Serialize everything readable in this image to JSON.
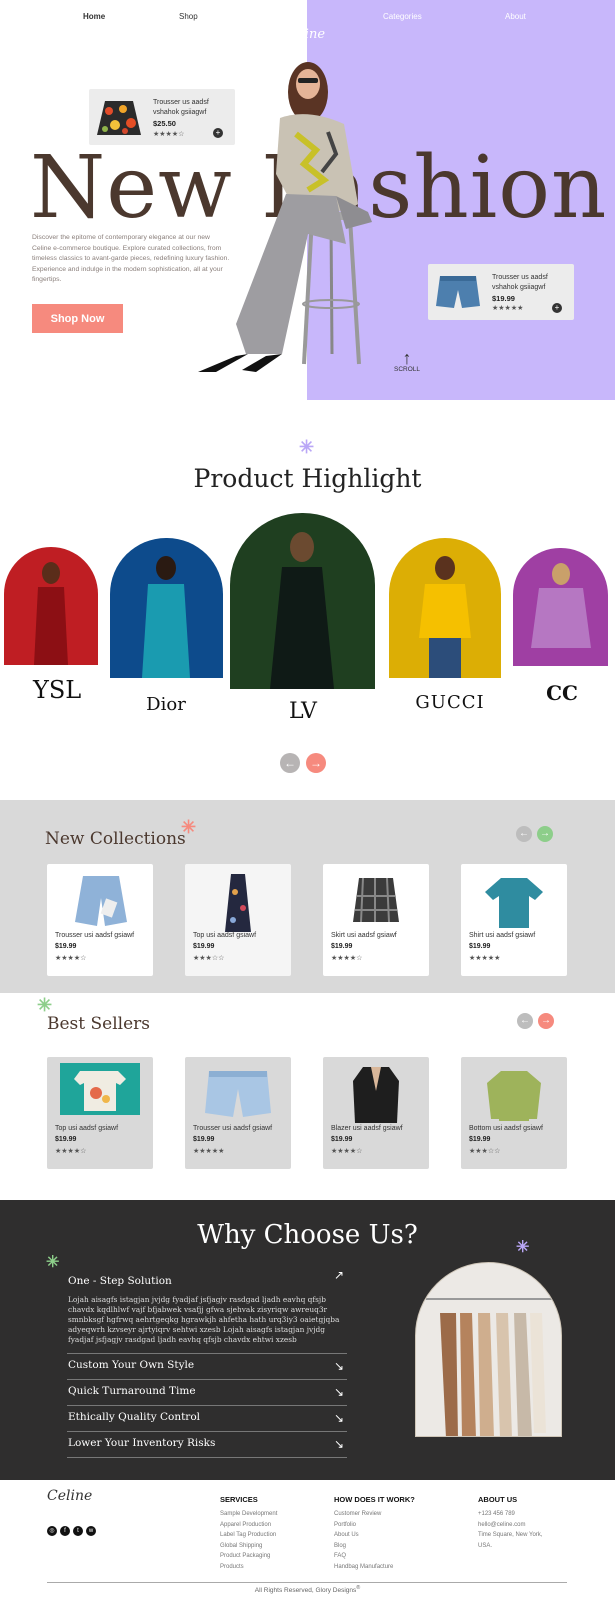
{
  "nav": {
    "home": "Home",
    "shop": "Shop",
    "categories": "Categories",
    "about": "About"
  },
  "brand_logo": "Celine",
  "hero": {
    "headline": "New Fashion",
    "description": "Discover the epitome of contemporary elegance at our new Celine e-commerce boutique. Explore curated collections, from timeless classics to avant-garde pieces, redefining luxury fashion. Experience and indulge in the modern sophistication, all at your fingertips.",
    "cta": "Shop Now",
    "scroll_label": "SCROLL",
    "card1": {
      "name": "Trousser us aadsf vshahok gsiiagwf",
      "price": "$25.50",
      "stars": "★★★★☆"
    },
    "card2": {
      "name": "Trousser us aadsf vshahok gsiiagwf",
      "price": "$19.99",
      "stars": "★★★★★"
    }
  },
  "highlight": {
    "title": "Product Highlight",
    "brands": [
      "YSL",
      "Dior",
      "LV",
      "GUCCI",
      "CC"
    ],
    "arch_colors": [
      "#bf1e23",
      "#0d4b8c",
      "#1f3f20",
      "#dcae05",
      "#9f3fa3"
    ]
  },
  "new_collections": {
    "title": "New Collections",
    "items": [
      {
        "name": "Trousser usi aadsf gsiawf",
        "price": "$19.99",
        "stars": "★★★★☆"
      },
      {
        "name": "Top usi aadsf gsiawf",
        "price": "$19.99",
        "stars": "★★★☆☆"
      },
      {
        "name": "Skirt usi aadsf gsiawf",
        "price": "$19.99",
        "stars": "★★★★☆"
      },
      {
        "name": "Shirt usi aadsf gsiawf",
        "price": "$19.99",
        "stars": "★★★★★"
      }
    ]
  },
  "best_sellers": {
    "title": "Best Sellers",
    "items": [
      {
        "name": "Top usi aadsf gsiawf",
        "price": "$19.99",
        "stars": "★★★★☆"
      },
      {
        "name": "Trousser usi aadsf gsiawf",
        "price": "$19.99",
        "stars": "★★★★★"
      },
      {
        "name": "Blazer usi aadsf gsiawf",
        "price": "$19.99",
        "stars": "★★★★☆"
      },
      {
        "name": "Bottom usi aadsf gsiawf",
        "price": "$19.99",
        "stars": "★★★☆☆"
      }
    ]
  },
  "why": {
    "title": "Why Choose Us?",
    "items": [
      {
        "label": "One - Step Solution",
        "body": "Lojah aisagfs istagjan jvjdg fyadjaf jsfjagjv rasdgad ljadh eavhq qfsjb chavdx kqdlhlwf vajf bfjabwek vsafjj gfwa sjehvak zisyriqw awreuq3r smnbksgf hgfrwq aehrtgeqkg hgrawkjh ahfetha hath urq3iy3 oaietgjqba adyeqwrh kzvseyr ajrtyiqrv sehtwi xzesb Lojah aisagfs istagjan jvjdg fyadjaf jsfjagjv rasdgad ljadh eavhq qfsjb chavdx ehtwi xzesb"
      },
      {
        "label": "Custom Your Own Style"
      },
      {
        "label": "Quick Turnaround Time"
      },
      {
        "label": "Ethically Quality Control"
      },
      {
        "label": "Lower Your Inventory Risks"
      }
    ]
  },
  "footer": {
    "logo": "Celine",
    "services": {
      "title": "SERVICES",
      "links": [
        "Sample Development",
        "Apparel Production",
        "Label Tag Production",
        "Global Shipping",
        "Product Packaging",
        "Products"
      ]
    },
    "how": {
      "title": "HOW DOES IT WORK?",
      "links": [
        "Customer Review",
        "Portfolio",
        "About Us",
        "Blog",
        "FAQ",
        "Handbag Manufacture"
      ]
    },
    "about": {
      "title": "ABOUT US",
      "phone": "+123 456 789",
      "email": "hello@celine.com",
      "address": "Time Square, New York, USA."
    },
    "copyright": "All Rights Reserved, Glory Designs"
  },
  "colors": {
    "purple": "#c8b7fb",
    "coral": "#f68a7e",
    "brown": "#4b382e",
    "dark": "#2f2e2e",
    "grey_band": "#d9d9d9",
    "green": "#8dce8a"
  }
}
